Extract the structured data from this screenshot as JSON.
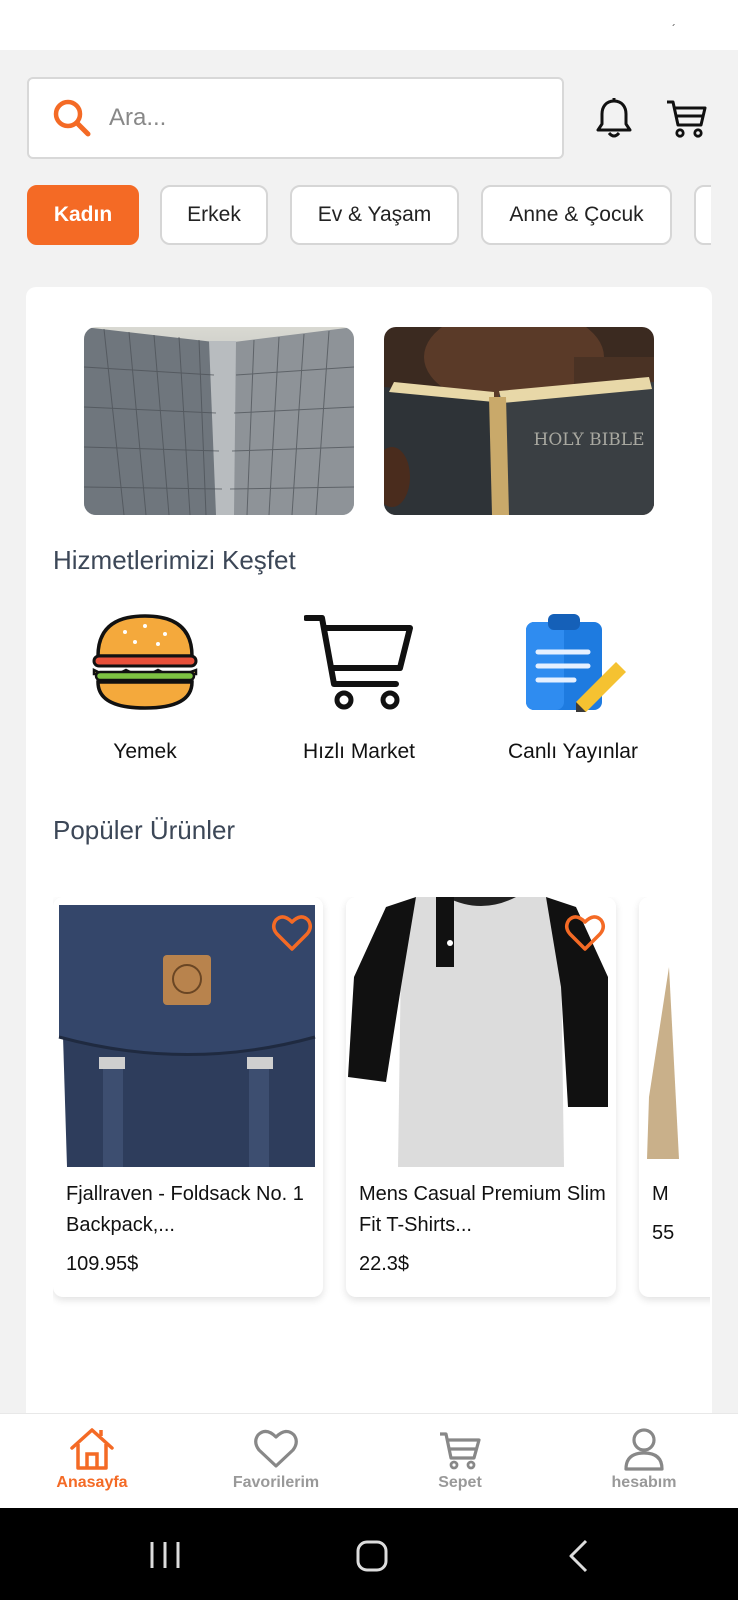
{
  "colors": {
    "accent": "#f46a25",
    "title": "#3c4757",
    "inactive": "#999999"
  },
  "status_bar": {
    "mark": "´"
  },
  "search": {
    "placeholder": "Ara...",
    "icon": "search-icon"
  },
  "header_icons": [
    "bell-icon",
    "cart-icon"
  ],
  "categories": [
    "Kadın",
    "Erkek",
    "Ev & Yaşam",
    "Anne & Çocuk"
  ],
  "banners": [
    {
      "name": "skyscraper-banner"
    },
    {
      "name": "holy-bible-banner",
      "text": "HOLY BIBLE"
    }
  ],
  "services": {
    "title": "Hizmetlerimizi Keşfet",
    "items": [
      {
        "label": "Yemek",
        "icon": "burger-icon"
      },
      {
        "label": "Hızlı Market",
        "icon": "shopping-cart-icon"
      },
      {
        "label": "Canlı Yayınlar",
        "icon": "clipboard-pencil-icon"
      }
    ]
  },
  "products": {
    "title": "Popüler Ürünler",
    "items": [
      {
        "name": "Fjallraven - Foldsack No. 1 Backpack,...",
        "price": "109.95$"
      },
      {
        "name": "Mens Casual Premium Slim Fit T-Shirts...",
        "price": "22.3$"
      },
      {
        "name": "M",
        "price": "55"
      }
    ]
  },
  "tabbar": {
    "items": [
      {
        "label": "Anasayfa",
        "icon": "home-icon",
        "active": true
      },
      {
        "label": "Favorilerim",
        "icon": "heart-icon",
        "active": false
      },
      {
        "label": "Sepet",
        "icon": "cart-icon",
        "active": false
      },
      {
        "label": "hesabım",
        "icon": "user-icon",
        "active": false
      }
    ]
  },
  "system_nav": [
    "recent-apps-icon",
    "home-circle-icon",
    "back-icon"
  ]
}
